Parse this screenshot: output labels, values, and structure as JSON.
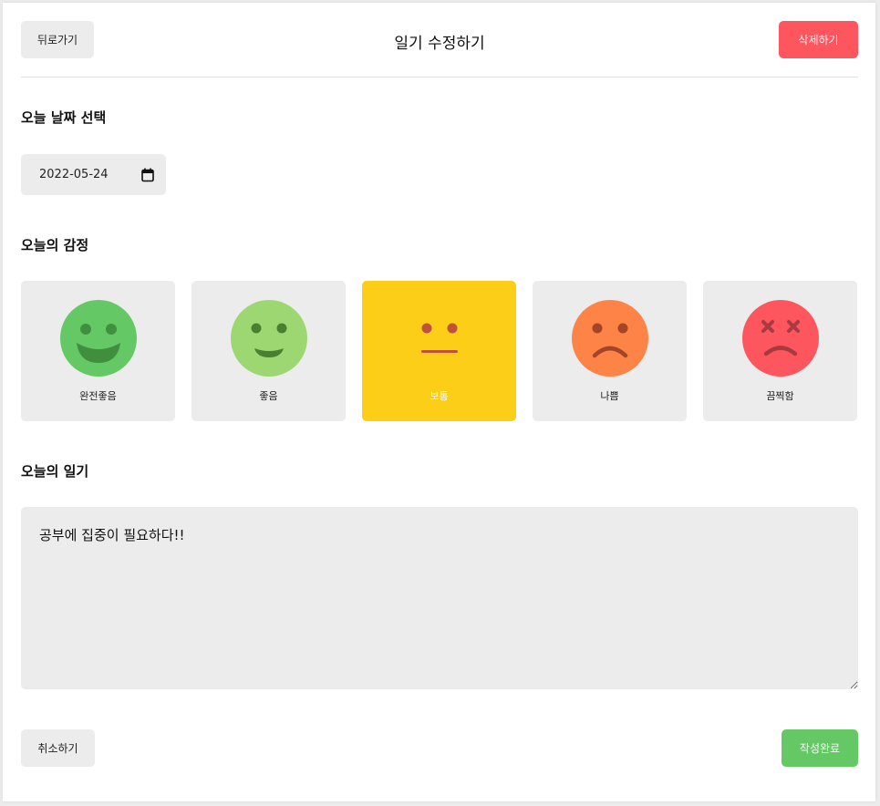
{
  "header": {
    "back_label": "뒤로가기",
    "title": "일기 수정하기",
    "delete_label": "삭제하기"
  },
  "date_section": {
    "title": "오늘 날짜 선택",
    "value": "2022-05-24",
    "icon": "calendar-icon"
  },
  "emotion_section": {
    "title": "오늘의 감정",
    "selected": "보통",
    "items": [
      {
        "label": "완전좋음",
        "icon": "very-happy-face-icon",
        "color": "#64c964"
      },
      {
        "label": "좋음",
        "icon": "happy-face-icon",
        "color": "#9dd772"
      },
      {
        "label": "보통",
        "icon": "neutral-face-icon",
        "color": "#fdce17"
      },
      {
        "label": "나쁨",
        "icon": "sad-face-icon",
        "color": "#fd8446"
      },
      {
        "label": "끔찍함",
        "icon": "terrible-face-icon",
        "color": "#fd565f"
      }
    ]
  },
  "diary_section": {
    "title": "오늘의 일기",
    "content": "공부에 집중이 필요하다!!"
  },
  "footer": {
    "cancel_label": "취소하기",
    "submit_label": "작성완료"
  },
  "colors": {
    "accent_red": "#fd565f",
    "accent_green": "#64c964",
    "accent_yellow": "#fdce17",
    "card_bg": "#ececec"
  }
}
